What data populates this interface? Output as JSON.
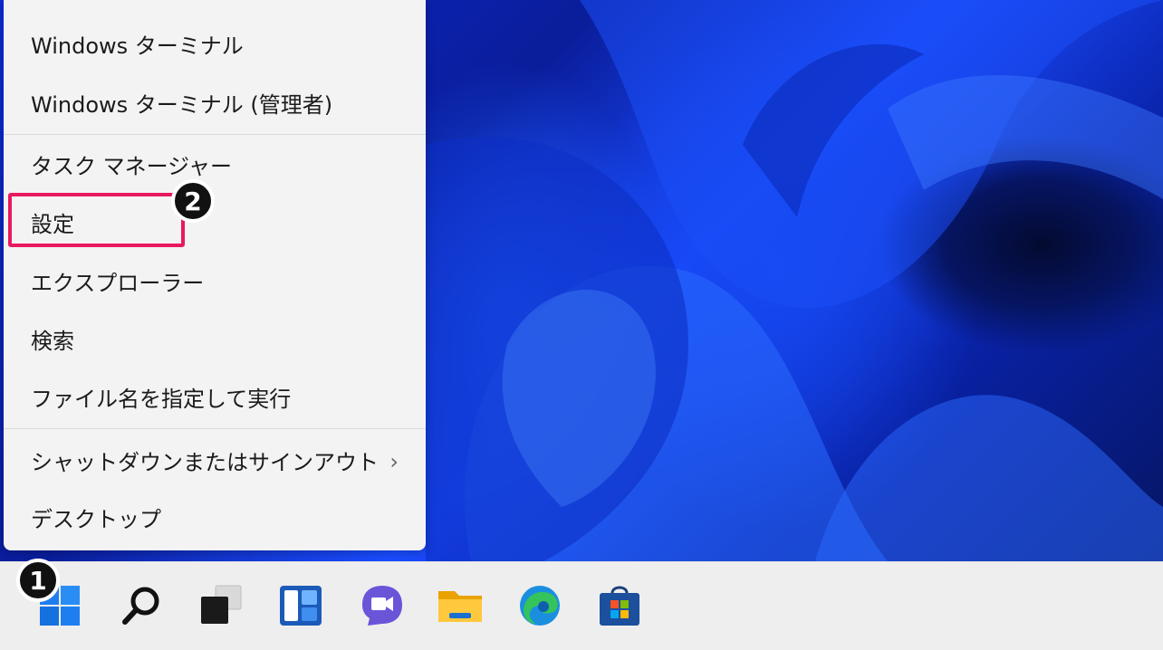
{
  "context_menu": {
    "items": [
      {
        "label": "Windows ターミナル"
      },
      {
        "label": "Windows ターミナル (管理者)"
      },
      {
        "label": "タスク マネージャー"
      },
      {
        "label": "設定"
      },
      {
        "label": "エクスプローラー"
      },
      {
        "label": "検索"
      },
      {
        "label": "ファイル名を指定して実行"
      },
      {
        "label": "シャットダウンまたはサインアウト",
        "submenu_indicator": "›"
      },
      {
        "label": "デスクトップ"
      }
    ]
  },
  "annotations": {
    "step1": "1",
    "step2": "2",
    "highlight_color": "#e8195e"
  },
  "taskbar": {
    "icons": [
      "windows-start-icon",
      "search-icon",
      "task-view-icon",
      "widgets-icon",
      "teams-chat-icon",
      "file-explorer-icon",
      "edge-browser-icon",
      "microsoft-store-icon"
    ]
  }
}
